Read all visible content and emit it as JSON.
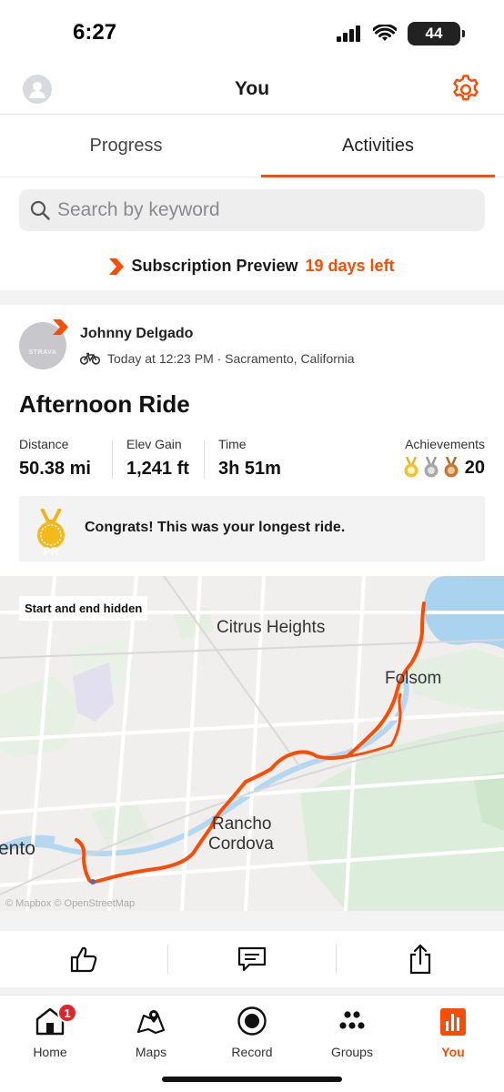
{
  "status_bar": {
    "time": "6:27",
    "battery": "44"
  },
  "header": {
    "title": "You"
  },
  "tabs": [
    {
      "label": "Progress",
      "active": false
    },
    {
      "label": "Activities",
      "active": true
    }
  ],
  "search": {
    "placeholder": "Search by keyword"
  },
  "subscription": {
    "label": "Subscription Preview",
    "days_left": "19 days left"
  },
  "activity": {
    "athlete_name": "Johnny Delgado",
    "avatar_text": "STRAVA",
    "meta": "Today at 12:23 PM · Sacramento, California",
    "title": "Afternoon Ride",
    "stats": [
      {
        "label": "Distance",
        "value": "50.38 mi"
      },
      {
        "label": "Elev Gain",
        "value": "1,241 ft"
      },
      {
        "label": "Time",
        "value": "3h 51m"
      }
    ],
    "achievements": {
      "label": "Achievements",
      "count": "20"
    },
    "pr_badge": "PR",
    "pr_message": "Congrats! This was your longest ride."
  },
  "map": {
    "badge": "Start and end hidden",
    "labels": {
      "citrus_heights": "Citrus Heights",
      "folsom": "Folsom",
      "rancho": "Rancho",
      "cordova": "Cordova",
      "sacramento_partial": "ento",
      "attribution": "© Mapbox © OpenStreetMap"
    },
    "route_color": "#fc4c02"
  },
  "bottom_nav": [
    {
      "label": "Home",
      "badge": "1"
    },
    {
      "label": "Maps"
    },
    {
      "label": "Record"
    },
    {
      "label": "Groups"
    },
    {
      "label": "You",
      "active": true
    }
  ],
  "colors": {
    "accent": "#fc4c02",
    "badge_red": "#e0262b"
  }
}
